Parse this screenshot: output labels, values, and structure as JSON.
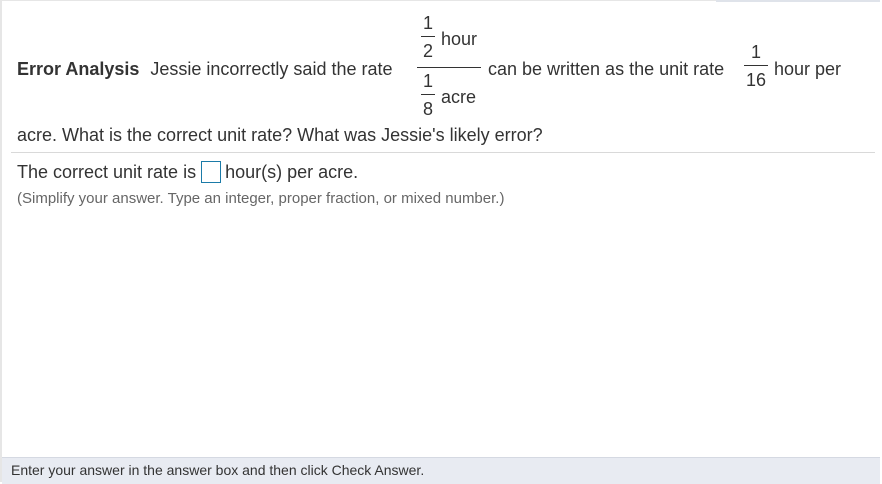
{
  "question": {
    "heading": "Error Analysis",
    "text_before": "Jessie incorrectly said the rate",
    "rate": {
      "numerator": {
        "num": "1",
        "den": "2",
        "unit": "hour"
      },
      "denominator": {
        "num": "1",
        "den": "8",
        "unit": "acre"
      }
    },
    "text_middle": "can be written as the unit rate",
    "unit_rate": {
      "num": "1",
      "den": "16"
    },
    "text_after": "hour per",
    "line2": "acre. What is the correct unit rate? What was Jessie's likely error?"
  },
  "answer": {
    "prefix": "The correct unit rate is",
    "suffix": "hour(s) per acre.",
    "value": "",
    "hint": "(Simplify your answer. Type an integer, proper fraction, or mixed number.)"
  },
  "footer": {
    "instruction": "Enter your answer in the answer box and then click Check Answer."
  },
  "colors": {
    "answer_box_border": "#1b7ba8",
    "footer_background": "#e8ebf2"
  }
}
